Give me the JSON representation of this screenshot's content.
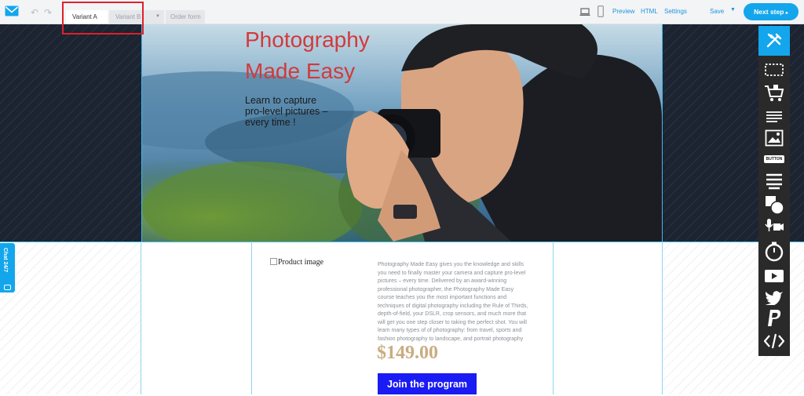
{
  "header": {
    "undo_icon": "undo-icon",
    "redo_icon": "redo-icon",
    "tabs": [
      {
        "label": "Variant A",
        "active": true
      },
      {
        "label": "Variant B",
        "active": false
      },
      {
        "label": "Order form",
        "active": false
      }
    ],
    "links": [
      "Preview",
      "HTML",
      "Settings"
    ],
    "save_label": "Save",
    "next_label": "Next step",
    "accent_color": "#13a6ec"
  },
  "hero": {
    "title_line1": "Photography",
    "title_line2": "Made Easy",
    "subtitle_line1": "Learn to capture",
    "subtitle_line2": "pro-level pictures –",
    "subtitle_line3": "every time !",
    "title_color": "#d23a3c"
  },
  "product": {
    "image_alt": "Product image",
    "description": "Photography Made Easy gives you the knowledge and skills you need to finally master your camera and capture pro-level pictures – every time. Delivered by an award-winning professional photographer, the Photography Made Easy course teaches you the most important functions and techniques of digital photography including the Rule of Thirds, depth-of-field, your DSLR, crop sensors, and much more that will get you one step closer to taking the perfect shot. You will learn many types of of photography: from travel, sports and fashion photography to landscape, and portrait photography",
    "price": "$149.00",
    "cta": "Join the program",
    "cta_color": "#1b1bf3"
  },
  "chat": {
    "label": "Chat 24/7"
  },
  "toolbox": {
    "button_tool_label": "BUTTON",
    "tools": [
      "tools-icon",
      "section-icon",
      "cart-icon",
      "text-icon",
      "image-icon",
      "button-icon",
      "form-icon",
      "shapes-icon",
      "media-icon",
      "timer-icon",
      "video-icon",
      "twitter-icon",
      "paypal-icon",
      "code-icon"
    ]
  }
}
